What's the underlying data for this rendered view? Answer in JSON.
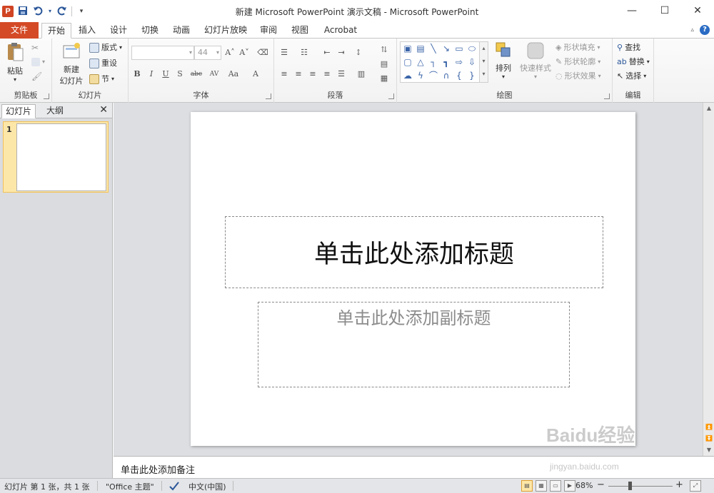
{
  "window": {
    "title": "新建 Microsoft PowerPoint 演示文稿 - Microsoft PowerPoint",
    "app_icon_letter": "P",
    "controls": [
      "—",
      "☐",
      "✕"
    ]
  },
  "qat": {
    "save_icon": "save-icon",
    "undo_icon": "undo-icon",
    "redo_icon": "redo-icon",
    "customize_icon": "customize-icon"
  },
  "ribbon_tabs": {
    "file": "文件",
    "tabs": [
      "开始",
      "插入",
      "设计",
      "切换",
      "动画",
      "幻灯片放映",
      "审阅",
      "视图",
      "Acrobat"
    ],
    "active_index": 0
  },
  "ribbon": {
    "clipboard": {
      "label": "剪贴板",
      "paste": "粘贴",
      "paste_arrow": "▾"
    },
    "slides": {
      "label": "幻灯片",
      "new_slide": "新建",
      "new_slide_line2": "幻灯片",
      "layout": "版式",
      "reset": "重设",
      "section": "节"
    },
    "font": {
      "label": "字体",
      "font_name": "",
      "font_size": "44",
      "bold": "B",
      "italic": "I",
      "underline": "U",
      "shadow": "S",
      "strike": "abc",
      "spacing": "AV",
      "case": "Aa",
      "color": "A",
      "grow": "A˄",
      "shrink": "A˅"
    },
    "paragraph": {
      "label": "段落"
    },
    "drawing": {
      "label": "绘图",
      "arrange": "排列",
      "quick_styles": "快速样式",
      "shape_fill": "形状填充",
      "shape_outline": "形状轮廓",
      "shape_effects": "形状效果"
    },
    "editing": {
      "label": "编辑",
      "find": "查找",
      "replace": "替换",
      "select": "选择"
    }
  },
  "left_panel": {
    "tabs": [
      "幻灯片",
      "大纲"
    ],
    "close": "✕",
    "slide_number": "1"
  },
  "slide": {
    "title_placeholder": "单击此处添加标题",
    "subtitle_placeholder": "单击此处添加副标题"
  },
  "notes": {
    "placeholder": "单击此处添加备注"
  },
  "statusbar": {
    "slide_info": "幻灯片 第 1 张，共 1 张",
    "theme": "\"Office 主题\"",
    "language": "中文(中国)",
    "zoom": "68%",
    "zoom_minus": "−",
    "zoom_plus": "+"
  },
  "watermark": {
    "text": "Baidu经验",
    "url": "jingyan.baidu.com"
  },
  "colors": {
    "file_tab": "#d44a26",
    "accent_blue": "#2a5699",
    "selection": "#fde7a8"
  }
}
